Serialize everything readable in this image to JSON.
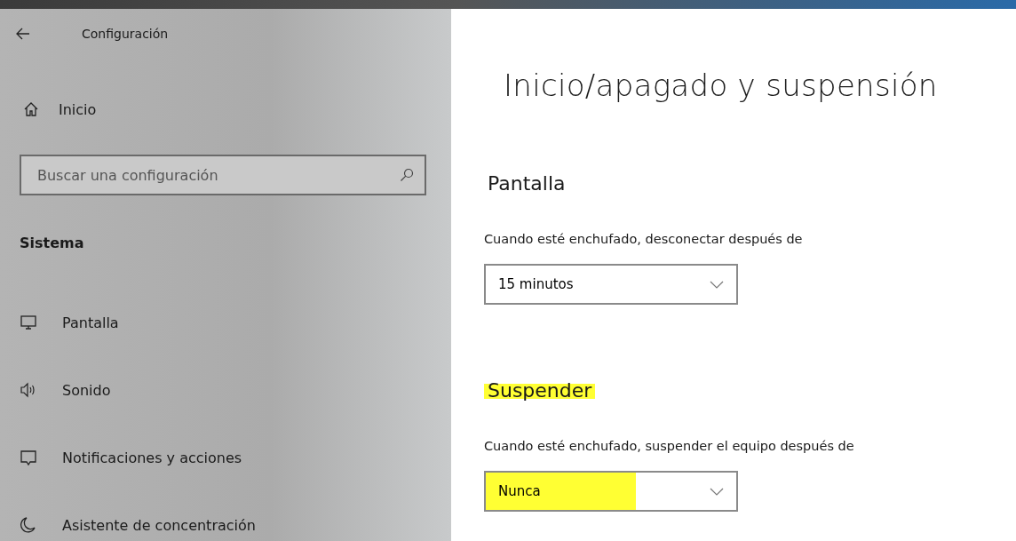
{
  "window": {
    "title": "Configuración"
  },
  "sidebar": {
    "home": "Inicio",
    "search": {
      "placeholder": "Buscar una configuración"
    },
    "section": "Sistema",
    "items": [
      {
        "label": "Pantalla"
      },
      {
        "label": "Sonido"
      },
      {
        "label": "Notificaciones y acciones"
      },
      {
        "label": "Asistente de concentración"
      }
    ]
  },
  "page": {
    "title": "Inicio/apagado y suspensión",
    "sections": [
      {
        "heading": "Pantalla",
        "highlighted": false,
        "label": "Cuando esté enchufado, desconectar después de",
        "value": "15 minutos",
        "value_highlighted": false
      },
      {
        "heading": "Suspender",
        "highlighted": true,
        "label": "Cuando esté enchufado, suspender el equipo después de",
        "value": "Nunca",
        "value_highlighted": true
      }
    ]
  }
}
